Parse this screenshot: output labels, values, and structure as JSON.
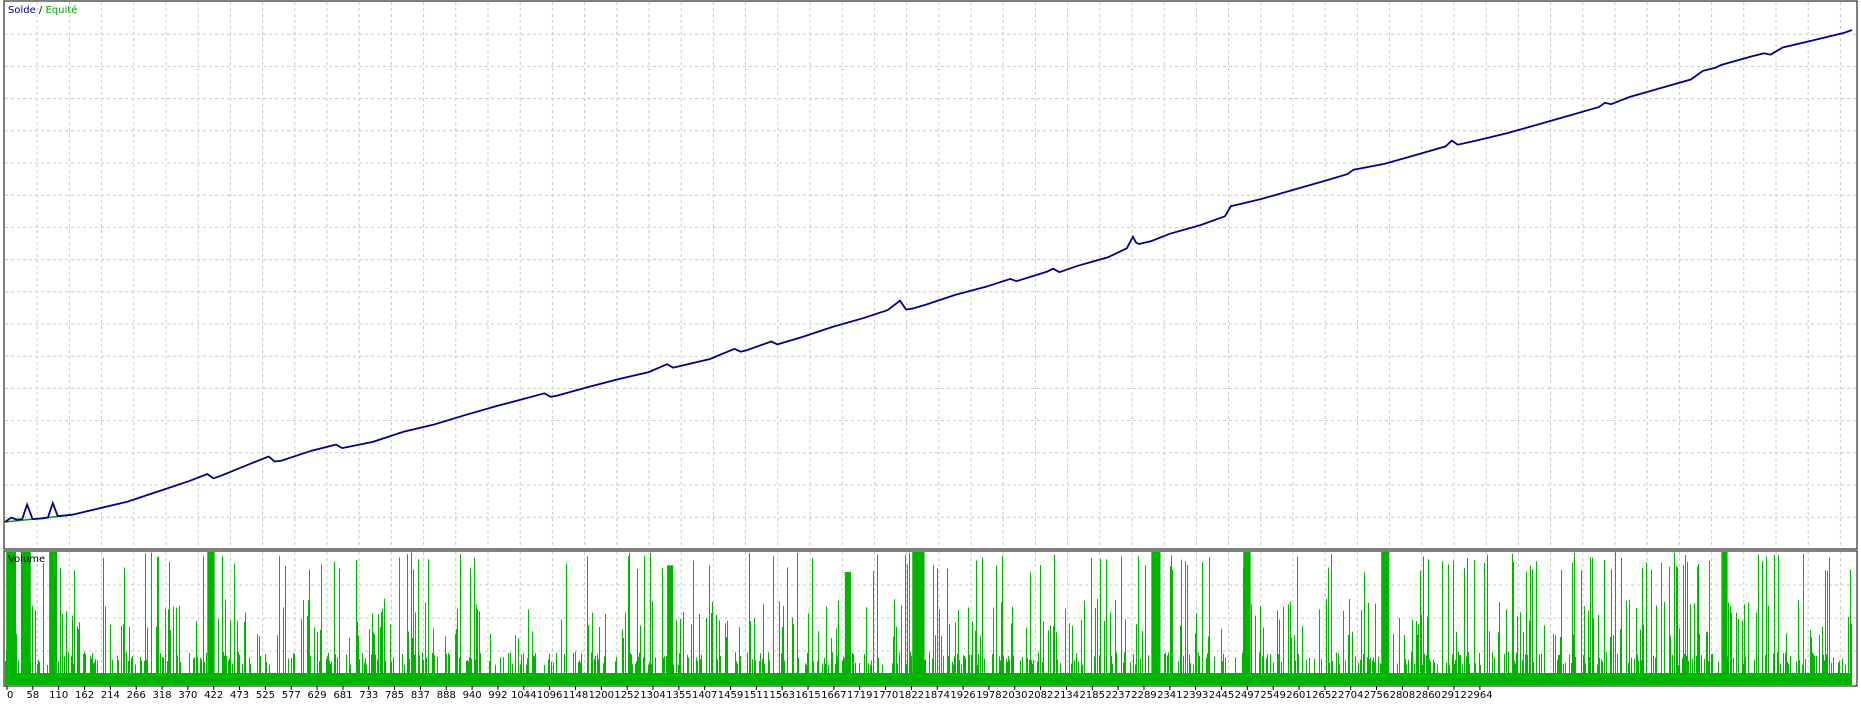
{
  "legend": {
    "balance_label": "Solde",
    "separator": " / ",
    "equity_label": "Equité"
  },
  "volume_panel": {
    "label": "Volume"
  },
  "colors": {
    "balance": "#00008b",
    "equity": "#00a000",
    "volume": "#00b400",
    "grid": "#c8c8c8",
    "frame": "#000000",
    "background": "#ffffff"
  },
  "chart_data": [
    {
      "type": "line",
      "title": "",
      "xlabel": "",
      "ylabel": "",
      "grid": true,
      "legend_position": "top-left",
      "x_ticks": [
        "0",
        "58",
        "110",
        "162",
        "214",
        "266",
        "318",
        "370",
        "422",
        "473",
        "525",
        "577",
        "629",
        "681",
        "733",
        "785",
        "837",
        "888",
        "940",
        "992",
        "1044",
        "1096",
        "1148",
        "1200",
        "1252",
        "1304",
        "1355",
        "1407",
        "1459",
        "1511",
        "1563",
        "1615",
        "1667",
        "1719",
        "1770",
        "1822",
        "1874",
        "1926",
        "1978",
        "2030",
        "2082",
        "2134",
        "2185",
        "2237",
        "2289",
        "2341",
        "2393",
        "2445",
        "2497",
        "2549",
        "2601",
        "2652",
        "2704",
        "2756",
        "2808",
        "2860",
        "2912",
        "2964"
      ],
      "xlim": [
        0,
        3013
      ],
      "ylim": [
        0,
        1000
      ],
      "series": [
        {
          "name": "Solde",
          "x": [
            0,
            10,
            20,
            28,
            36,
            45,
            60,
            70,
            78,
            86,
            95,
            110,
            150,
            200,
            250,
            300,
            330,
            340,
            350,
            400,
            430,
            440,
            450,
            500,
            540,
            550,
            560,
            600,
            650,
            700,
            750,
            800,
            850,
            880,
            890,
            900,
            950,
            1000,
            1050,
            1080,
            1090,
            1100,
            1150,
            1190,
            1200,
            1210,
            1250,
            1260,
            1300,
            1350,
            1400,
            1440,
            1460,
            1470,
            1480,
            1500,
            1550,
            1600,
            1640,
            1650,
            1700,
            1710,
            1720,
            1750,
            1800,
            1830,
            1840,
            1845,
            1850,
            1870,
            1900,
            1950,
            1990,
            2000,
            2010,
            2050,
            2100,
            2150,
            2190,
            2200,
            2250,
            2300,
            2350,
            2360,
            2370,
            2400,
            2450,
            2500,
            2550,
            2600,
            2610,
            2620,
            2650,
            2700,
            2750,
            2770,
            2790,
            2800,
            2850,
            2870,
            2880,
            2900,
            2950,
            3000,
            3013
          ],
          "values": [
            0,
            15,
            8,
            10,
            60,
            10,
            12,
            15,
            65,
            20,
            22,
            25,
            45,
            70,
            105,
            140,
            165,
            150,
            157,
            200,
            225,
            208,
            210,
            245,
            266,
            254,
            258,
            275,
            310,
            335,
            367,
            397,
            425,
            442,
            430,
            434,
            463,
            490,
            515,
            542,
            530,
            535,
            560,
            595,
            585,
            590,
            620,
            610,
            635,
            670,
            700,
            728,
            760,
            730,
            733,
            745,
            780,
            808,
            835,
            827,
            860,
            870,
            858,
            880,
            910,
            940,
            980,
            960,
            955,
            965,
            990,
            1020,
            1050,
            1085,
            1090,
            1110,
            1140,
            1170,
            1195,
            1210,
            1230,
            1260,
            1290,
            1310,
            1296,
            1310,
            1335,
            1365,
            1395,
            1425,
            1440,
            1435,
            1460,
            1490,
            1520,
            1550,
            1560,
            1570,
            1600,
            1610,
            1605,
            1630,
            1655,
            1680,
            1690
          ]
        },
        {
          "name": "Equité",
          "x": [
            0,
            100,
            110
          ],
          "values": [
            0,
            22,
            25
          ]
        }
      ]
    },
    {
      "type": "bar",
      "title": "Volume",
      "xlim": [
        0,
        3013
      ],
      "ylim": [
        0,
        100
      ],
      "grid": true,
      "series": [
        {
          "name": "Volume",
          "bands": [
            [
              2,
              18,
              100
            ],
            [
              26,
              42,
              100
            ],
            [
              72,
              85,
              100
            ],
            [
              330,
              342,
              100
            ],
            [
              1080,
              1090,
              90
            ],
            [
              1370,
              1380,
              85
            ],
            [
              1480,
              1500,
              100
            ],
            [
              1870,
              1885,
              100
            ],
            [
              2020,
              2032,
              100
            ],
            [
              2245,
              2258,
              100
            ],
            [
              2800,
              2810,
              100
            ]
          ]
        }
      ]
    }
  ]
}
